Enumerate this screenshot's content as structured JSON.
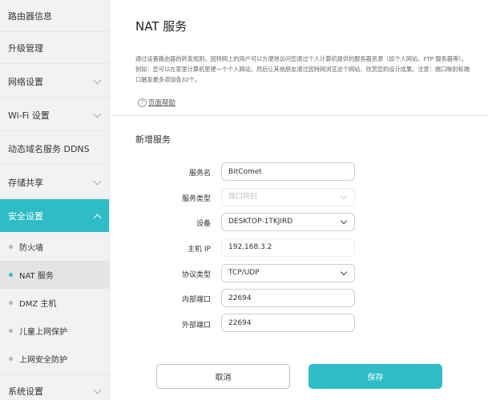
{
  "sidebar": {
    "items": [
      {
        "label": "路由器信息",
        "has_chevron": false
      },
      {
        "label": "升级管理",
        "has_chevron": false
      },
      {
        "label": "网络设置",
        "has_chevron": true
      },
      {
        "label": "Wi-Fi 设置",
        "has_chevron": true
      },
      {
        "label": "动态域名服务 DDNS",
        "has_chevron": false
      },
      {
        "label": "存储共享",
        "has_chevron": true
      },
      {
        "label": "安全设置",
        "has_chevron": true,
        "active": true
      },
      {
        "label": "系统设置",
        "has_chevron": true
      }
    ],
    "sub_items": [
      {
        "label": "防火墙"
      },
      {
        "label": "NAT 服务",
        "selected": true
      },
      {
        "label": "DMZ 主机"
      },
      {
        "label": "儿童上网保护"
      },
      {
        "label": "上网安全防护"
      }
    ]
  },
  "main": {
    "title": "NAT 服务",
    "description": "通过设置路由器的转发规则，因特网上的用户可以方便地访问您通过个人计算机提供的服务器资源（如个人网站、FTP 服务器等）。例如：您可以在家里计算机里建一个个人网站，然后让其他朋友通过因特网浏览这个网站、欣赏您的设计成果。注意：端口映射和端口触发最多添加各32个。",
    "help_label": "页面帮助",
    "section_title": "新增服务",
    "form": {
      "service_name_label": "服务名",
      "service_name_value": "BitComet",
      "service_type_label": "服务类型",
      "service_type_value": "端口映射",
      "device_label": "设备",
      "device_value": "DESKTOP-1TKJIRD",
      "host_ip_label": "主机 IP",
      "host_ip_value": "192.168.3.2",
      "protocol_label": "协议类型",
      "protocol_value": "TCP/UDP",
      "internal_port_label": "内部端口",
      "internal_port_value": "22694",
      "external_port_label": "外部端口",
      "external_port_value": "22694"
    },
    "buttons": {
      "cancel": "取消",
      "save": "保存"
    }
  },
  "colors": {
    "accent": "#2ebdc6",
    "sidebar_bg": "#f2f2f2"
  }
}
